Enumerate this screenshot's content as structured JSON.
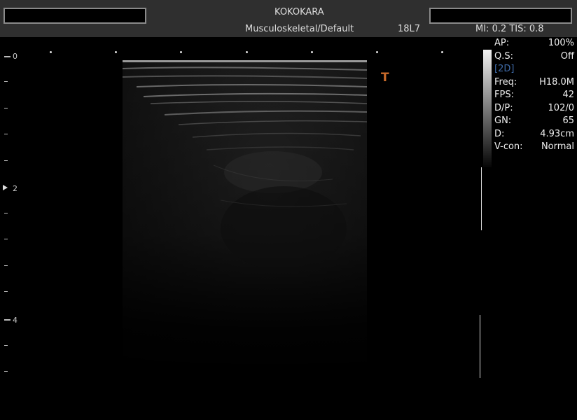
{
  "header": {
    "hospital": "KOKOKARA",
    "preset": "Musculoskeletal/Default",
    "probe": "18L7",
    "mi_tis": "MI:  0.2  TIS:  0.8"
  },
  "depth_scale": {
    "labels": [
      "0",
      "2",
      "4"
    ]
  },
  "orientation_marker": "T",
  "params": {
    "mode": "[2D]",
    "rows": [
      {
        "label": "AP:",
        "value": "100%"
      },
      {
        "label": "Q.S:",
        "value": "Off"
      },
      {
        "label": "Freq:",
        "value": "H18.0M"
      },
      {
        "label": "FPS:",
        "value": "42"
      },
      {
        "label": "D/P:",
        "value": "102/0"
      },
      {
        "label": "GN:",
        "value": "65"
      },
      {
        "label": "D:",
        "value": "4.93cm"
      },
      {
        "label": "V-con:",
        "value": "Normal"
      }
    ]
  }
}
